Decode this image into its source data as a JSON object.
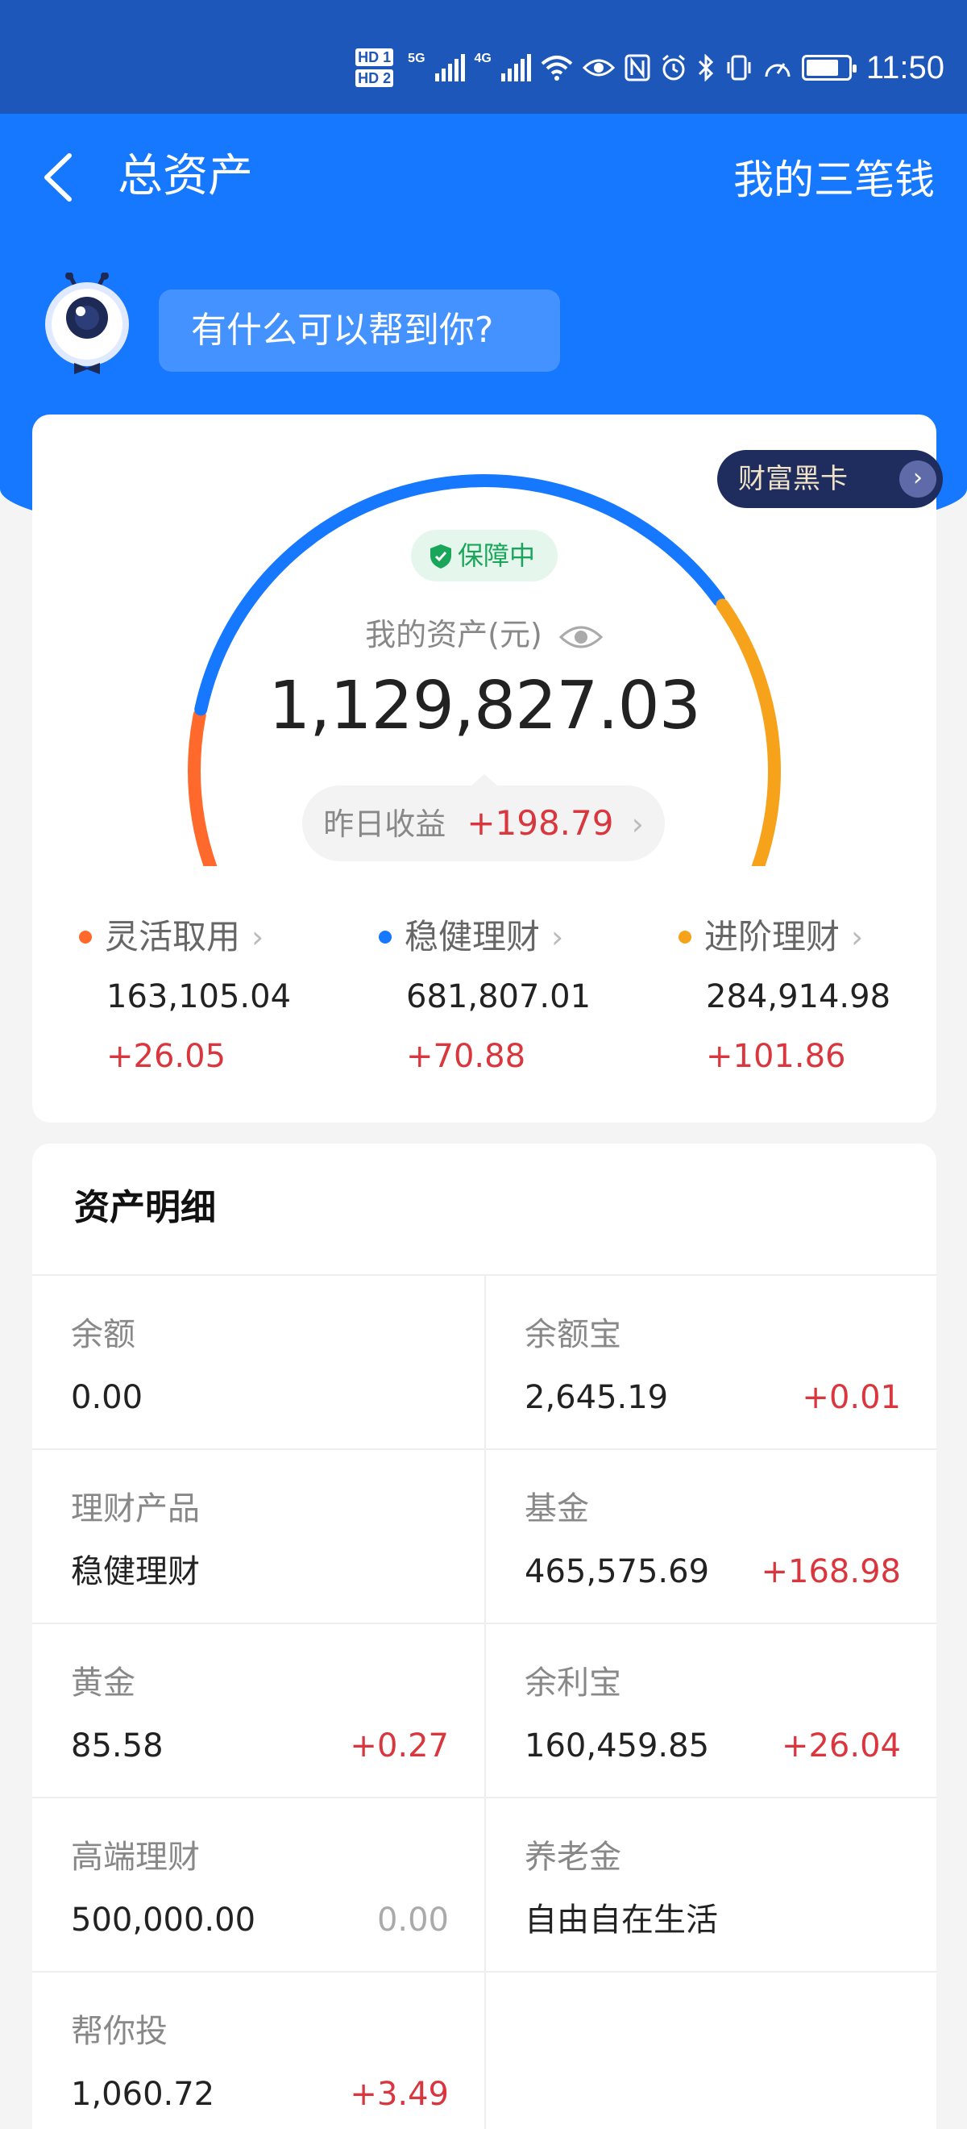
{
  "status_bar": {
    "time": "11:50",
    "network_label": "5G",
    "network2_label": "4G",
    "hd1": "HD 1",
    "hd2": "HD 2"
  },
  "nav": {
    "title": "总资产",
    "right_link": "我的三笔钱"
  },
  "assistant": {
    "prompt": "有什么可以帮到你?"
  },
  "assets_card": {
    "black_card_label": "财富黑卡",
    "protection_badge": "保障中",
    "assets_label": "我的资产(元)",
    "assets_value": "1,129,827.03",
    "yesterday_label": "昨日收益",
    "yesterday_value": "+198.79",
    "categories": [
      {
        "name": "灵活取用",
        "amount": "163,105.04",
        "change": "+26.05",
        "color": "#ff6a2c"
      },
      {
        "name": "稳健理财",
        "amount": "681,807.01",
        "change": "+70.88",
        "color": "#1677ff"
      },
      {
        "name": "进阶理财",
        "amount": "284,914.98",
        "change": "+101.86",
        "color": "#f7a21b"
      }
    ],
    "gauge_fractions": [
      0.144,
      0.604,
      0.252
    ]
  },
  "detail": {
    "title": "资产明细",
    "rows": [
      [
        {
          "label": "余额",
          "value": "0.00",
          "change": ""
        },
        {
          "label": "余额宝",
          "value": "2,645.19",
          "change": "+0.01"
        }
      ],
      [
        {
          "label": "理财产品",
          "value": "稳健理财",
          "change": ""
        },
        {
          "label": "基金",
          "value": "465,575.69",
          "change": "+168.98"
        }
      ],
      [
        {
          "label": "黄金",
          "value": "85.58",
          "change": "+0.27"
        },
        {
          "label": "余利宝",
          "value": "160,459.85",
          "change": "+26.04"
        }
      ],
      [
        {
          "label": "高端理财",
          "value": "500,000.00",
          "change": "0.00"
        },
        {
          "label": "养老金",
          "value": "自由自在生活",
          "change": ""
        }
      ],
      [
        {
          "label": "帮你投",
          "value": "1,060.72",
          "change": "+3.49"
        },
        {
          "label": "",
          "value": "",
          "change": ""
        }
      ]
    ]
  },
  "colors": {
    "header_blue": "#1677ff",
    "status_blue": "#1d57b9",
    "gain_red": "#d9363e",
    "protect_green": "#1aa65a"
  }
}
